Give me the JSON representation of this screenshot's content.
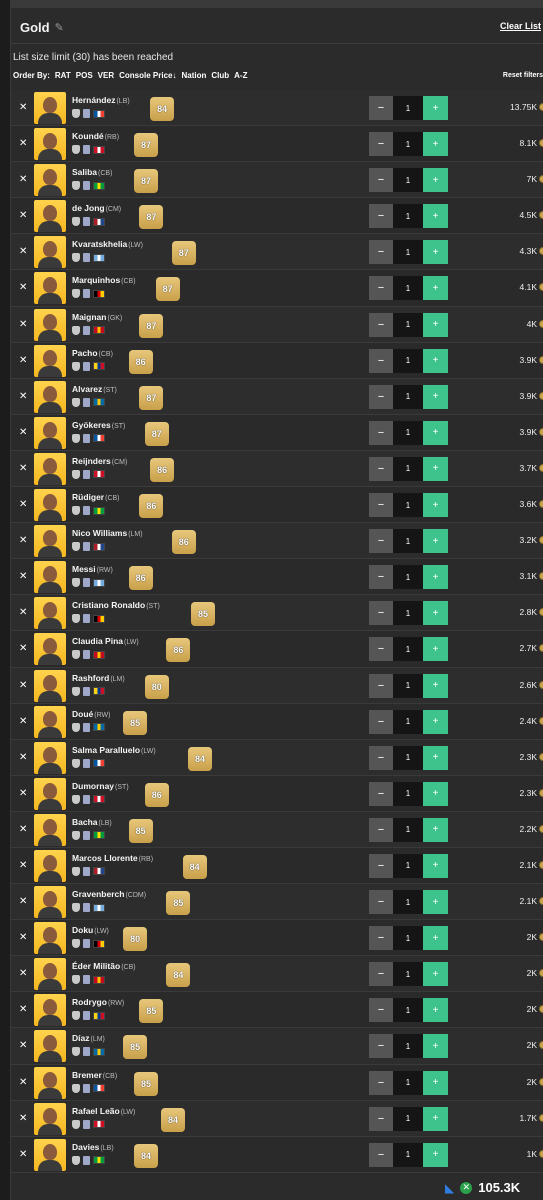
{
  "header": {
    "title": "Gold",
    "clear_label": "Clear List"
  },
  "limit_message": "List size limit (30) has been reached",
  "order_by": {
    "label": "Order By:",
    "options": [
      "RAT",
      "POS",
      "VER",
      "Console Price↓",
      "Nation",
      "Club",
      "A-Z"
    ]
  },
  "reset_label": "Reset filters",
  "players": [
    {
      "name": "Hernández",
      "pos": "(LB)",
      "rating": "84",
      "qty": "1",
      "price": "13.75K"
    },
    {
      "name": "Koundé",
      "pos": "(RB)",
      "rating": "87",
      "qty": "1",
      "price": "8.1K"
    },
    {
      "name": "Saliba",
      "pos": "(CB)",
      "rating": "87",
      "qty": "1",
      "price": "7K"
    },
    {
      "name": "de Jong",
      "pos": "(CM)",
      "rating": "87",
      "qty": "1",
      "price": "4.5K"
    },
    {
      "name": "Kvaratskhelia",
      "pos": "(LW)",
      "rating": "87",
      "qty": "1",
      "price": "4.3K"
    },
    {
      "name": "Marquinhos",
      "pos": "(CB)",
      "rating": "87",
      "qty": "1",
      "price": "4.1K"
    },
    {
      "name": "Maignan",
      "pos": "(GK)",
      "rating": "87",
      "qty": "1",
      "price": "4K"
    },
    {
      "name": "Pacho",
      "pos": "(CB)",
      "rating": "86",
      "qty": "1",
      "price": "3.9K"
    },
    {
      "name": "Alvarez",
      "pos": "(ST)",
      "rating": "87",
      "qty": "1",
      "price": "3.9K"
    },
    {
      "name": "Gyökeres",
      "pos": "(ST)",
      "rating": "87",
      "qty": "1",
      "price": "3.9K"
    },
    {
      "name": "Reijnders",
      "pos": "(CM)",
      "rating": "86",
      "qty": "1",
      "price": "3.7K"
    },
    {
      "name": "Rüdiger",
      "pos": "(CB)",
      "rating": "86",
      "qty": "1",
      "price": "3.6K"
    },
    {
      "name": "Nico Williams",
      "pos": "(LM)",
      "rating": "86",
      "qty": "1",
      "price": "3.2K"
    },
    {
      "name": "Messi",
      "pos": "(RW)",
      "rating": "86",
      "qty": "1",
      "price": "3.1K"
    },
    {
      "name": "Cristiano Ronaldo",
      "pos": "(ST)",
      "rating": "85",
      "qty": "1",
      "price": "2.8K"
    },
    {
      "name": "Claudia Pina",
      "pos": "(LW)",
      "rating": "86",
      "qty": "1",
      "price": "2.7K"
    },
    {
      "name": "Rashford",
      "pos": "(LM)",
      "rating": "80",
      "qty": "1",
      "price": "2.6K"
    },
    {
      "name": "Doué",
      "pos": "(RW)",
      "rating": "85",
      "qty": "1",
      "price": "2.4K"
    },
    {
      "name": "Salma Paralluelo",
      "pos": "(LW)",
      "rating": "84",
      "qty": "1",
      "price": "2.3K"
    },
    {
      "name": "Dumornay",
      "pos": "(ST)",
      "rating": "86",
      "qty": "1",
      "price": "2.3K"
    },
    {
      "name": "Bacha",
      "pos": "(LB)",
      "rating": "85",
      "qty": "1",
      "price": "2.2K"
    },
    {
      "name": "Marcos Llorente",
      "pos": "(RB)",
      "rating": "84",
      "qty": "1",
      "price": "2.1K"
    },
    {
      "name": "Gravenberch",
      "pos": "(CDM)",
      "rating": "85",
      "qty": "1",
      "price": "2.1K"
    },
    {
      "name": "Doku",
      "pos": "(LW)",
      "rating": "80",
      "qty": "1",
      "price": "2K"
    },
    {
      "name": "Éder Militão",
      "pos": "(CB)",
      "rating": "84",
      "qty": "1",
      "price": "2K"
    },
    {
      "name": "Rodrygo",
      "pos": "(RW)",
      "rating": "85",
      "qty": "1",
      "price": "2K"
    },
    {
      "name": "Díaz",
      "pos": "(LM)",
      "rating": "85",
      "qty": "1",
      "price": "2K"
    },
    {
      "name": "Bremer",
      "pos": "(CB)",
      "rating": "85",
      "qty": "1",
      "price": "2K"
    },
    {
      "name": "Rafael Leão",
      "pos": "(LW)",
      "rating": "84",
      "qty": "1",
      "price": "1.7K"
    },
    {
      "name": "Davies",
      "pos": "(LB)",
      "rating": "84",
      "qty": "1",
      "price": "1K"
    }
  ],
  "footer": {
    "total": "105.3K"
  },
  "colors": {
    "plus_green": "#3ec38c",
    "rating_gold": "#d7b261",
    "avatar_yellow": "#f5b71f"
  }
}
